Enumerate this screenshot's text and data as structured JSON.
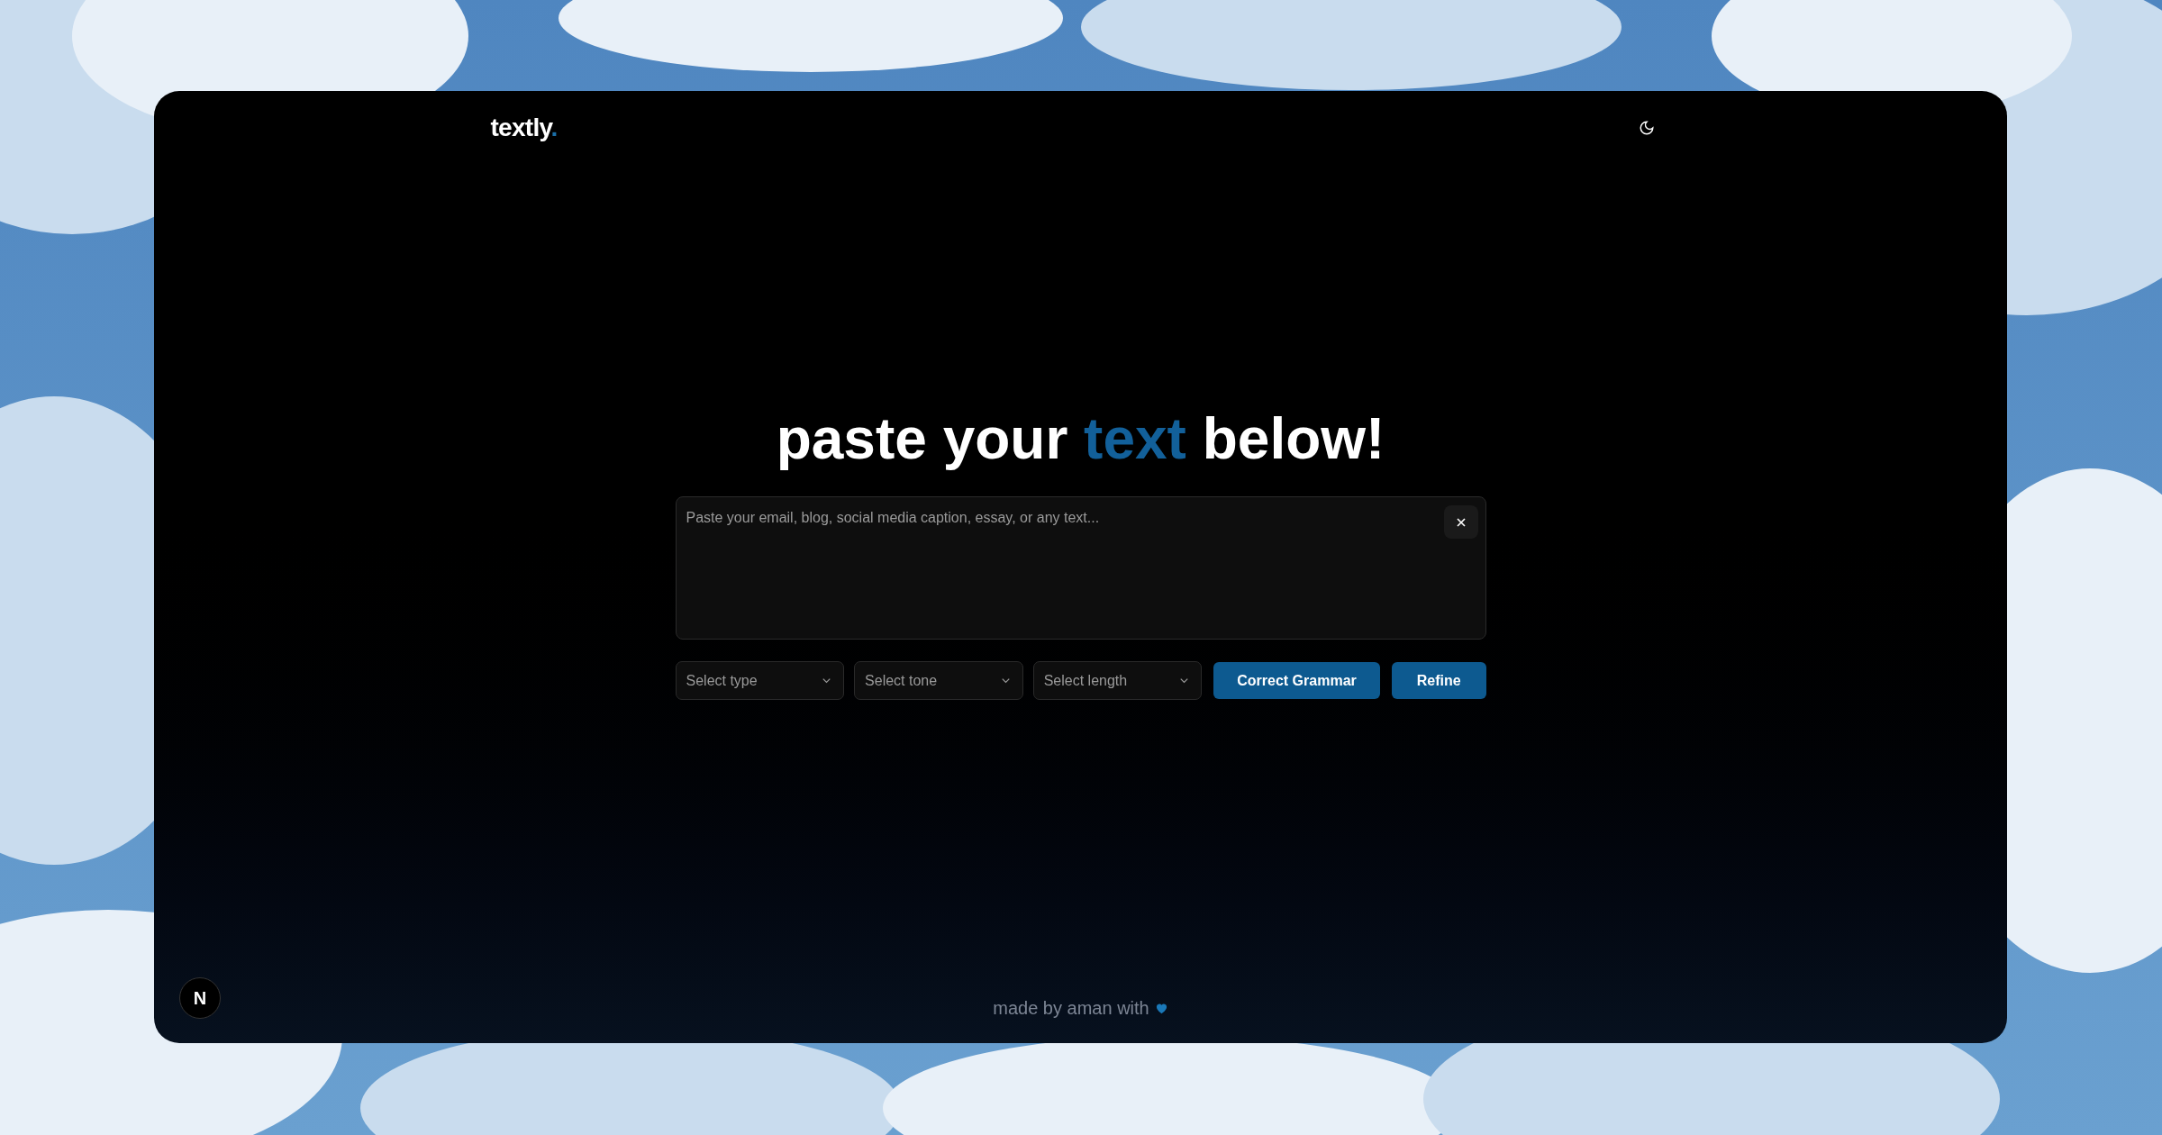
{
  "header": {
    "logo": {
      "text": "textly",
      "mark": "."
    }
  },
  "heading": [
    {
      "text": "paste your",
      "highlight": false
    },
    {
      "text": "text",
      "highlight": true
    },
    {
      "text": "below!",
      "highlight": false
    }
  ],
  "editor": {
    "placeholder": "Paste your email, blog, social media caption, essay, or any text..."
  },
  "selects": [
    {
      "placeholder": "Select type"
    },
    {
      "placeholder": "Select tone"
    },
    {
      "placeholder": "Select length"
    }
  ],
  "buttons": [
    "Correct Grammar",
    "Refine"
  ],
  "footer": {
    "text": "made by aman with"
  },
  "dev_badge": {
    "text": "N"
  }
}
